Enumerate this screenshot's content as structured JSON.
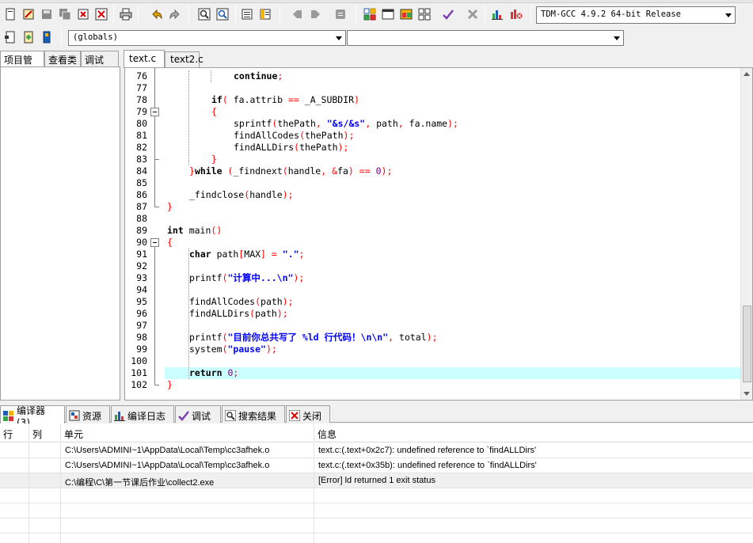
{
  "toolbar": {
    "icons": [
      "new-file-icon",
      "open-project-icon",
      "save-icon",
      "save-all-icon",
      "close-icon",
      "print-icon",
      "undo-icon",
      "redo-icon",
      "find-icon",
      "replace-icon",
      "indent-icon",
      "unindent-icon",
      "back-icon",
      "forward-icon",
      "toggle-comment-icon",
      "compile-icon",
      "run-icon",
      "compile-run-icon",
      "rebuild-icon",
      "syntax-check-icon",
      "stop-icon",
      "chart-icon",
      "profile-icon"
    ],
    "compiler_label": "TDM-GCC 4.9.2 64-bit Release"
  },
  "toolbar2": {
    "scope_label": "(globals)",
    "function_label": ""
  },
  "left_panel": {
    "tabs": [
      "项目管理",
      "查看类",
      "调试"
    ]
  },
  "editor": {
    "tabs": [
      "text.c",
      "text2.c"
    ],
    "active_tab": "text.c",
    "highlighted_line": "101",
    "lines": [
      {
        "n": "76",
        "text": "continue;"
      },
      {
        "n": "77",
        "text": ""
      },
      {
        "n": "78",
        "text": "if( fa.attrib == _A_SUBDIR)"
      },
      {
        "n": "79",
        "text": "{"
      },
      {
        "n": "80",
        "text": "sprintf(thePath, \"&s/&s\", path, fa.name);"
      },
      {
        "n": "81",
        "text": "findAllCodes(thePath);"
      },
      {
        "n": "82",
        "text": "findALLDirs(thePath);"
      },
      {
        "n": "83",
        "text": "}"
      },
      {
        "n": "84",
        "text": "}while (_findnext(handle, &fa) == 0);"
      },
      {
        "n": "85",
        "text": ""
      },
      {
        "n": "86",
        "text": "_findclose(handle);"
      },
      {
        "n": "87",
        "text": "}"
      },
      {
        "n": "88",
        "text": ""
      },
      {
        "n": "89",
        "text": "int main()"
      },
      {
        "n": "90",
        "text": "{"
      },
      {
        "n": "91",
        "text": "char path[MAX] = \".\";"
      },
      {
        "n": "92",
        "text": ""
      },
      {
        "n": "93",
        "text": "printf(\"计算中...\\n\");"
      },
      {
        "n": "94",
        "text": ""
      },
      {
        "n": "95",
        "text": "findAllCodes(path);"
      },
      {
        "n": "96",
        "text": "findALLDirs(path);"
      },
      {
        "n": "97",
        "text": ""
      },
      {
        "n": "98",
        "text": "printf(\"目前你总共写了 %ld 行代码！\\n\\n\", total);"
      },
      {
        "n": "99",
        "text": "system(\"pause\");"
      },
      {
        "n": "100",
        "text": ""
      },
      {
        "n": "101",
        "text": "return 0;"
      },
      {
        "n": "102",
        "text": "}"
      }
    ]
  },
  "bottom_panel": {
    "tabs": [
      {
        "label": "编译器 (3)",
        "icon": "compiler-icon"
      },
      {
        "label": "资源",
        "icon": "resources-icon"
      },
      {
        "label": "编译日志",
        "icon": "compile-log-icon"
      },
      {
        "label": "调试",
        "icon": "debug-icon"
      },
      {
        "label": "搜索结果",
        "icon": "search-results-icon"
      },
      {
        "label": "关闭",
        "icon": "close-panel-icon"
      }
    ],
    "columns": [
      "行",
      "列",
      "单元",
      "信息"
    ],
    "rows": [
      {
        "line": "",
        "col": "",
        "unit": "C:\\Users\\ADMINI~1\\AppData\\Local\\Temp\\cc3afhek.o",
        "message": "text.c:(.text+0x2c7): undefined reference to `findALLDirs'"
      },
      {
        "line": "",
        "col": "",
        "unit": "C:\\Users\\ADMINI~1\\AppData\\Local\\Temp\\cc3afhek.o",
        "message": "text.c:(.text+0x35b): undefined reference to `findALLDirs'"
      },
      {
        "line": "",
        "col": "",
        "unit": "C:\\编程\\C\\第一节课后作业\\collect2.exe",
        "message": "[Error] ld returned 1 exit status"
      }
    ]
  },
  "colors": {
    "highlight_line": "#ccffff",
    "keyword": "#000000",
    "string": "#0000ff",
    "symbol": "#ff0000",
    "number": "#800080"
  }
}
